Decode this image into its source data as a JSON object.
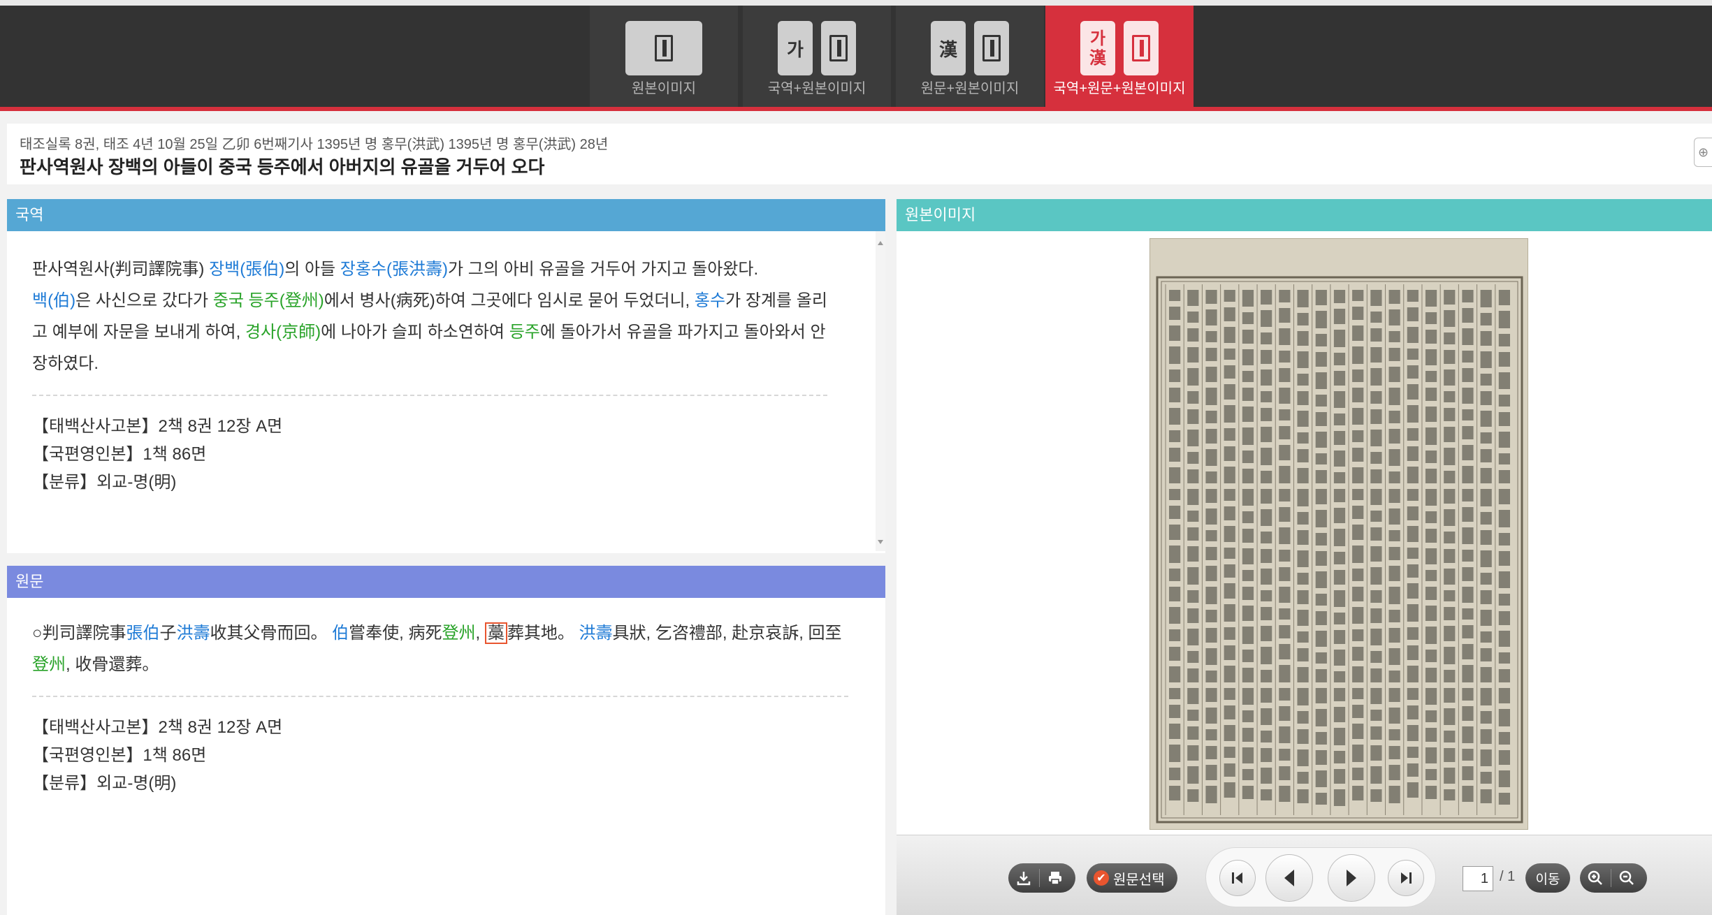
{
  "view_tabs": [
    {
      "label": "원본이미지",
      "icon": "book-icon",
      "active": false
    },
    {
      "label": "국역+원본이미지",
      "icon": "korean-book-icon",
      "glyph": "가",
      "active": false
    },
    {
      "label": "원문+원본이미지",
      "icon": "hanja-book-icon",
      "glyph": "漢",
      "active": false
    },
    {
      "label": "국역+원문+원본이미지",
      "icon": "korean-hanja-book-icon",
      "glyph_top": "가",
      "glyph_bottom": "漢",
      "active": true
    }
  ],
  "article": {
    "subtitle": "태조실록 8권, 태조 4년 10월 25일 乙卯 6번째기사 1395년 명 홍무(洪武) 1395년 명 홍무(洪武) 28년",
    "title": "판사역원사 장백의 아들이 중국 등주에서 아버지의 유골을 거두어 오다"
  },
  "translation": {
    "header": "국역",
    "segments": {
      "s1": "판사역원사(判司譯院事) ",
      "l1": "장백(張伯)",
      "s2": "의 아들 ",
      "l2": "장홍수(張洪壽)",
      "s3": "가 그의 아비 유골을 거두어 가지고 돌아왔다.",
      "l3": "백(伯)",
      "s4": "은 사신으로 갔다가 ",
      "l4": "중국 등주(登州)",
      "s5": "에서 병사(病死)하여 그곳에다 임시로 묻어 두었더니, ",
      "l5": "홍수",
      "s6": "가 장계를 올리고 예부에 자문을 보내게 하여, ",
      "l6": "경사(京師)",
      "s7": "에 나아가 슬피 하소연하여 ",
      "l7": "등주",
      "s8": "에 돌아가서 유골을 파가지고 돌아와서 안장하였다."
    },
    "meta": [
      {
        "label": "【태백산사고본】",
        "value": "2책 8권 12장 A면"
      },
      {
        "label": "【국편영인본】",
        "value": "1책 86면"
      },
      {
        "label": "【분류】",
        "value": "외교-명(明)"
      }
    ]
  },
  "original": {
    "header": "원문",
    "segments": {
      "s1": "○判司譯院事",
      "l1": "張伯",
      "s2": "子",
      "l2": "洪壽",
      "s3": "收其父骨而回。 ",
      "l3": "伯",
      "s4": "嘗奉使, 病死",
      "l4": "登州",
      "s5": ", ",
      "boxed": "藁",
      "s6": "葬其地。 ",
      "l5": "洪壽",
      "s7": "具狀, 乞咨禮部, 赴京哀訴, 回至",
      "l6": "登州",
      "s8": ", 收骨還葬。"
    },
    "meta": [
      {
        "label": "【태백산사고본】",
        "value": "2책 8권 12장 A면"
      },
      {
        "label": "【국편영인본】",
        "value": "1책 86면"
      },
      {
        "label": "【분류】",
        "value": "외교-명(明)"
      }
    ]
  },
  "image_panel": {
    "header": "원본이미지"
  },
  "viewer": {
    "select_label": "원문선택",
    "page_current": "1",
    "page_total": "/ 1",
    "go_label": "이동"
  }
}
